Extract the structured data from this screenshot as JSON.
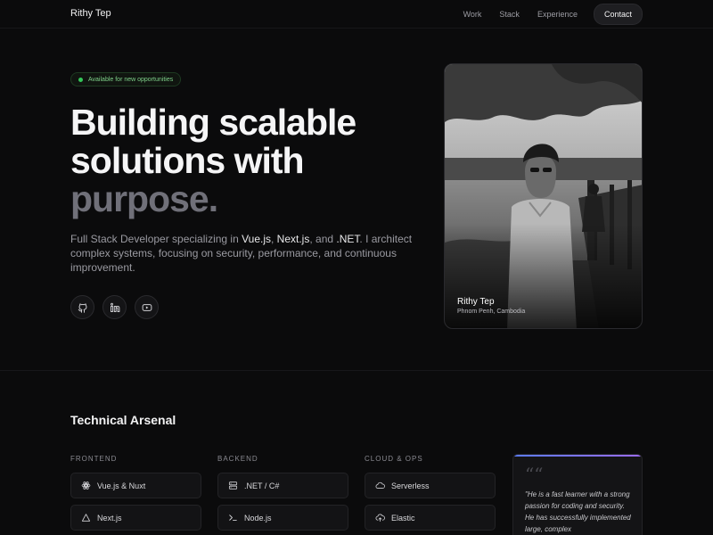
{
  "nav": {
    "brand": "Rithy Tep",
    "links": [
      "Work",
      "Stack",
      "Experience"
    ],
    "contact": "Contact"
  },
  "hero": {
    "badge": "Available for new opportunities",
    "headline_line1": "Building scalable",
    "headline_line2": "solutions with",
    "headline_line3": "purpose.",
    "desc_prefix": "Full Stack Developer specializing in ",
    "desc_tech1": "Vue.js",
    "desc_sep1": ", ",
    "desc_tech2": "Next.js",
    "desc_sep2": ", and ",
    "desc_tech3": ".NET",
    "desc_suffix": ". I architect complex systems, focusing on security, performance, and continuous improvement.",
    "socials": [
      "github-icon",
      "linkedin-icon",
      "youtube-icon"
    ]
  },
  "photo": {
    "name": "Rithy Tep",
    "location": "Phnom Penh, Cambodia"
  },
  "arsenal": {
    "title": "Technical Arsenal",
    "columns": [
      {
        "label": "FRONTEND",
        "items": [
          {
            "icon": "vue-icon",
            "label": "Vue.js & Nuxt"
          },
          {
            "icon": "triangle-icon",
            "label": "Next.js"
          }
        ]
      },
      {
        "label": "BACKEND",
        "items": [
          {
            "icon": "server-icon",
            "label": ".NET / C#"
          },
          {
            "icon": "terminal-icon",
            "label": "Node.js"
          }
        ]
      },
      {
        "label": "CLOUD & OPS",
        "items": [
          {
            "icon": "cloud-icon",
            "label": "Serverless"
          },
          {
            "icon": "cloud-upload-icon",
            "label": "Elastic"
          }
        ]
      }
    ]
  },
  "quote": {
    "mark": "““",
    "text": "\"He is a fast learner with a strong passion for coding and security. He has successfully implemented large, complex"
  },
  "colors": {
    "background": "#0b0b0c",
    "accent_green": "#34c759",
    "muted_headline": "#707079",
    "quote_gradient_start": "#5b7cfa",
    "quote_gradient_end": "#9b6cf5"
  }
}
